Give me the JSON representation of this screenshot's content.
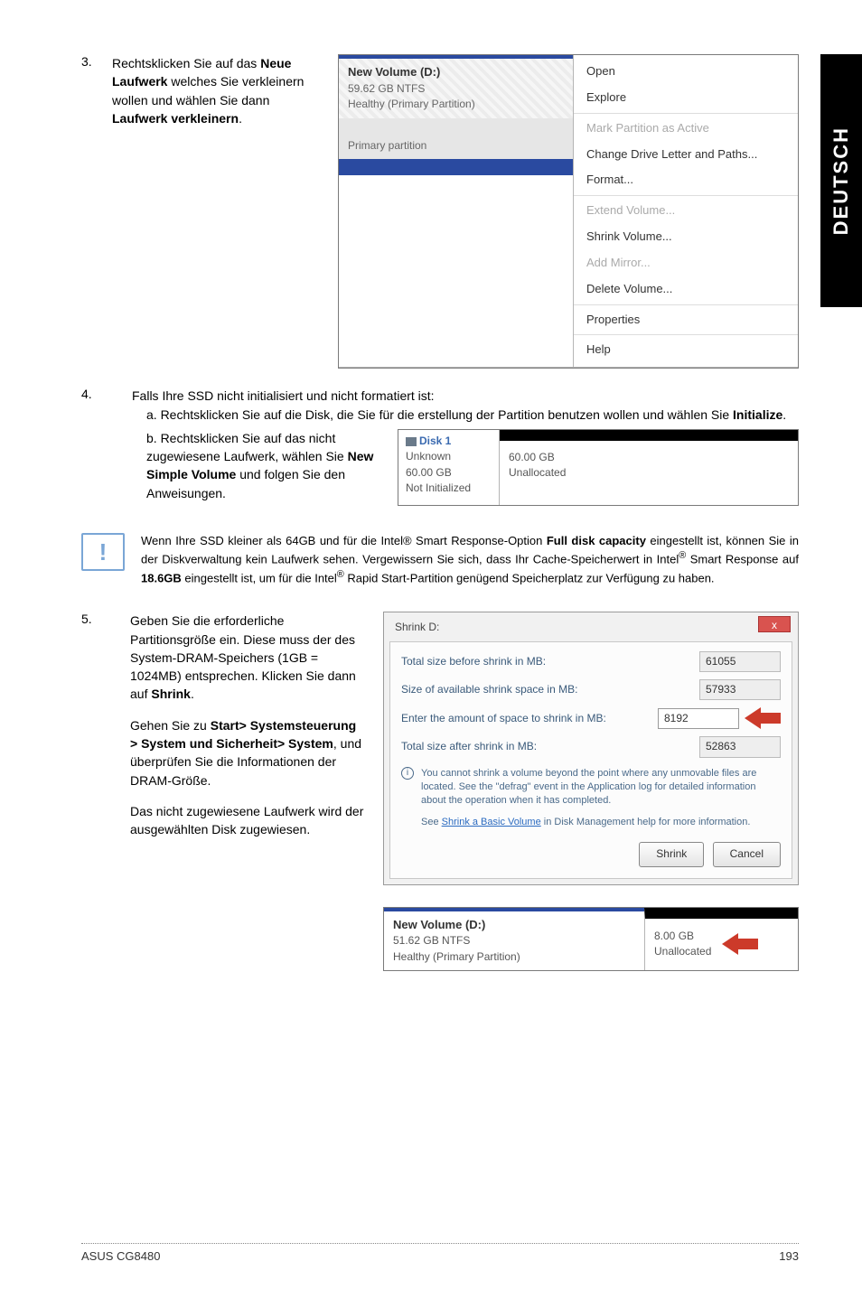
{
  "side_tab": "DEUTSCH",
  "step3": {
    "num": "3.",
    "text_before": "Rechtsklicken Sie auf das ",
    "bold1": "Neue Laufwerk",
    "text_mid": " welches Sie verkleinern wollen und wählen Sie dann ",
    "bold2": "Laufwerk verkleinern",
    "text_after": "."
  },
  "ss1": {
    "vol_title": "New Volume  (D:)",
    "vol_size": "59.62 GB NTFS",
    "vol_health": "Healthy (Primary Partition)",
    "primary": "Primary partition",
    "menu": {
      "open": "Open",
      "explore": "Explore",
      "mark": "Mark Partition as Active",
      "change": "Change Drive Letter and Paths...",
      "format": "Format...",
      "extend": "Extend Volume...",
      "shrink": "Shrink Volume...",
      "mirror": "Add Mirror...",
      "delete": "Delete Volume...",
      "props": "Properties",
      "help": "Help"
    }
  },
  "step4": {
    "num": "4.",
    "intro": "Falls Ihre SSD nicht initialisiert und nicht formatiert ist:",
    "a_before": "a. Rechtsklicken Sie auf die Disk, die Sie für die erstellung der Partition benutzen wollen und wählen Sie ",
    "a_bold": "Initialize",
    "a_after": ".",
    "b_before": "b. Rechtsklicken Sie auf das nicht zugewiesene Laufwerk, wählen Sie ",
    "b_bold": "New Simple Volume",
    "b_after": " und folgen Sie den Anweisungen."
  },
  "ss2": {
    "disk": "Disk 1",
    "unknown": "Unknown",
    "size": "60.00 GB",
    "status": "Not Initialized",
    "r_size": "60.00 GB",
    "r_unalloc": "Unallocated"
  },
  "note": {
    "p1a": "Wenn Ihre SSD kleiner als 64GB und für die Intel® Smart Response-Option ",
    "p1b": "Full disk capacity",
    "p1c": " eingestellt ist, können Sie in der Diskverwaltung kein Laufwerk sehen. Vergewissern Sie sich, dass Ihr Cache-Speicherwert in Intel",
    "p1d": "®",
    "p1e": " Smart Response auf ",
    "p1f": "18.6GB",
    "p1g": " eingestellt ist, um für die Intel",
    "p1h": "®",
    "p1i": " Rapid Start-Partition genügend Speicherplatz zur Verfügung zu haben."
  },
  "step5": {
    "num": "5.",
    "p1a": "Geben Sie die erforderliche Partitionsgröße ein. Diese muss der des System-DRAM-Speichers (1GB = 1024MB) entsprechen. Klicken Sie dann auf ",
    "p1b": "Shrink",
    "p1c": ".",
    "p2a": "Gehen Sie zu ",
    "p2b": "Start> Systemsteuerung > System und Sicherheit> System",
    "p2c": ", und überprüfen Sie die Informationen der DRAM-Größe.",
    "p3": "Das nicht zugewiesene Laufwerk wird der ausgewählten Disk zugewiesen."
  },
  "ss3": {
    "title": "Shrink D:",
    "f1_label": "Total size before shrink in MB:",
    "f1_val": "61055",
    "f2_label": "Size of available shrink space in MB:",
    "f2_val": "57933",
    "f3_label": "Enter the amount of space to shrink in MB:",
    "f3_val": "8192",
    "f4_label": "Total size after shrink in MB:",
    "f4_val": "52863",
    "info1": "You cannot shrink a volume beyond the point where any unmovable files are located. See the \"defrag\" event in the Application log for detailed information about the operation when it has completed.",
    "info2a": "See ",
    "info2b": "Shrink a Basic Volume",
    "info2c": " in Disk Management help for more information.",
    "btn_shrink": "Shrink",
    "btn_cancel": "Cancel"
  },
  "ss4": {
    "vol_title": "New Volume  (D:)",
    "vol_size": "51.62 GB NTFS",
    "vol_health": "Healthy (Primary Partition)",
    "r_size": "8.00 GB",
    "r_unalloc": "Unallocated"
  },
  "footer": {
    "left": "ASUS CG8480",
    "right": "193"
  }
}
